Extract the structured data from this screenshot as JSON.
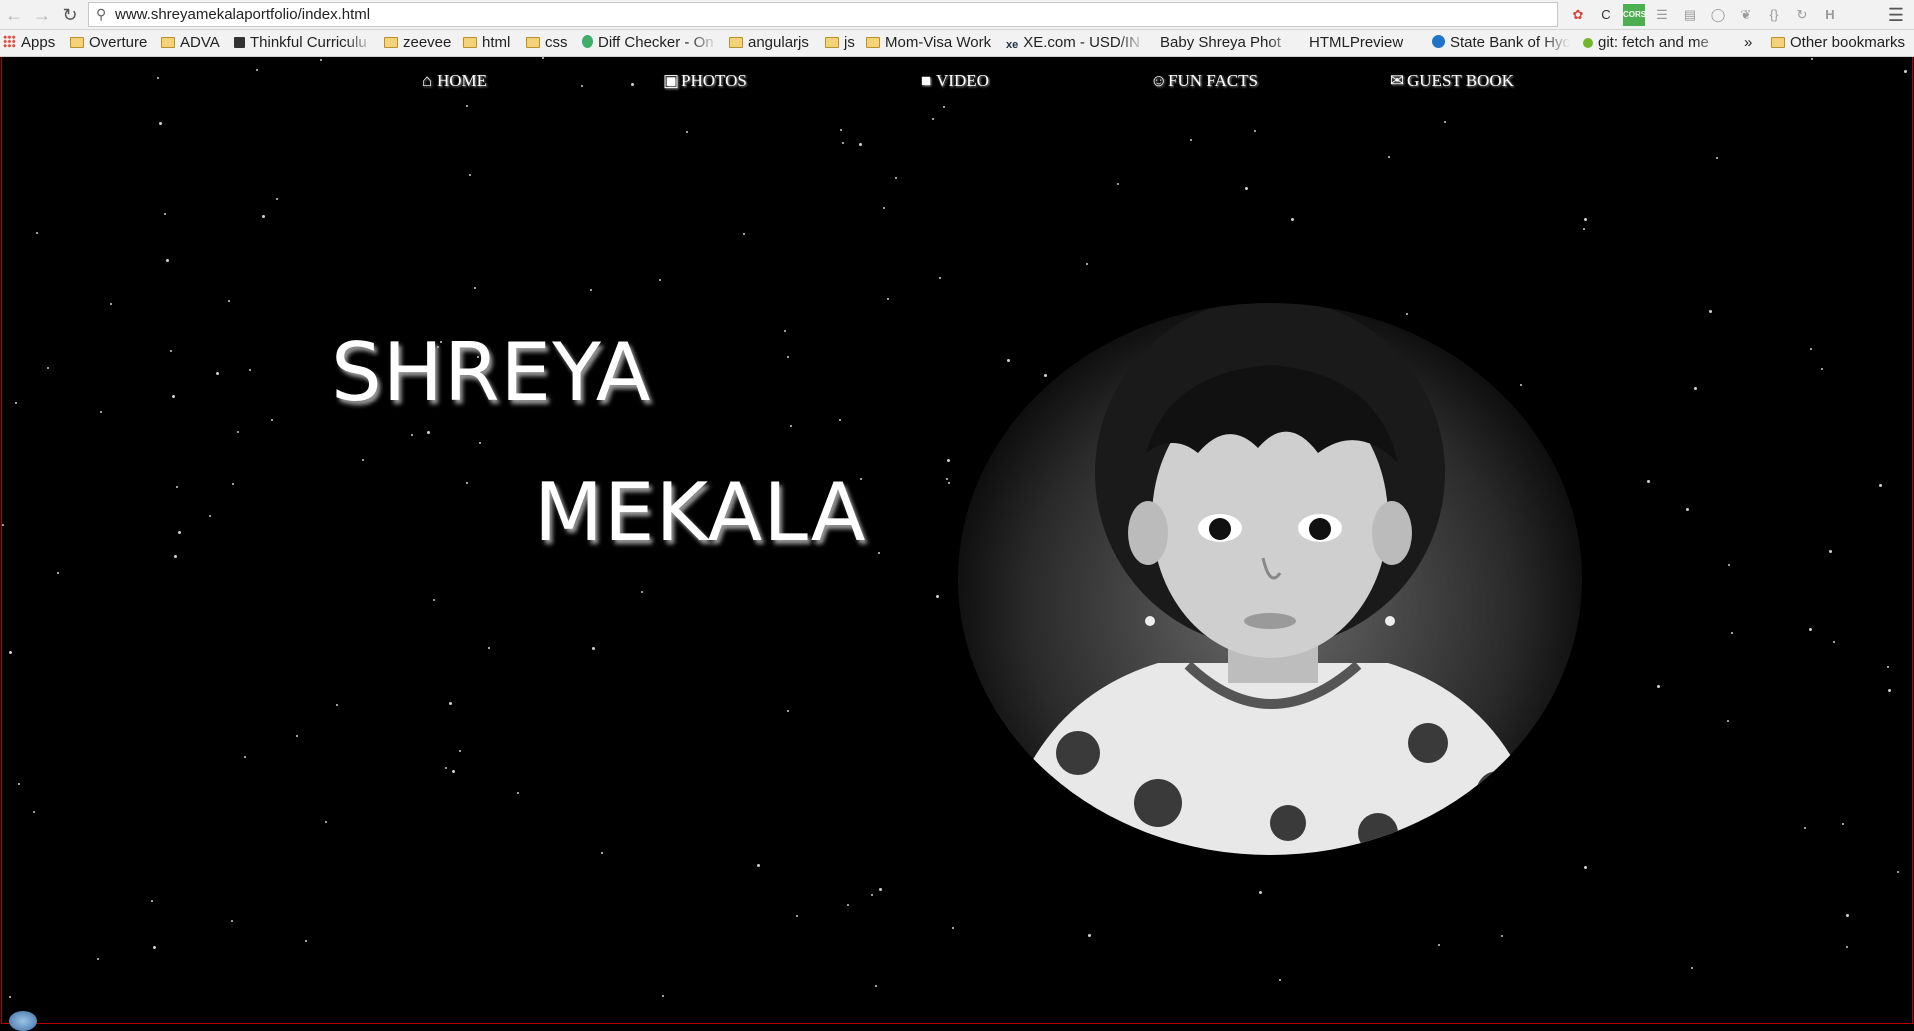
{
  "browser": {
    "url": "www.shreyamekalaportfolio/index.html",
    "bookmarks": [
      {
        "label": "Apps",
        "icon": "apps-grid-icon"
      },
      {
        "label": "Overture",
        "icon": "folder-icon"
      },
      {
        "label": "ADVA",
        "icon": "folder-icon"
      },
      {
        "label": "Thinkful Curriculu",
        "icon": "thinkful-icon"
      },
      {
        "label": "zeevee",
        "icon": "folder-icon"
      },
      {
        "label": "html",
        "icon": "folder-icon"
      },
      {
        "label": "css",
        "icon": "folder-icon"
      },
      {
        "label": "Diff Checker - On",
        "icon": "diffchecker-icon"
      },
      {
        "label": "angularjs",
        "icon": "folder-icon"
      },
      {
        "label": "js",
        "icon": "folder-icon"
      },
      {
        "label": "Mom-Visa Work",
        "icon": "folder-icon"
      },
      {
        "label": "XE.com - USD/IN",
        "icon": "xe-icon"
      },
      {
        "label": "Baby Shreya Phot",
        "icon": "page-icon"
      },
      {
        "label": "HTMLPreview",
        "icon": "page-icon"
      },
      {
        "label": "State Bank of Hyc",
        "icon": "sbh-icon"
      },
      {
        "label": "git: fetch and me",
        "icon": "git-icon"
      }
    ],
    "overflow": "»",
    "other_bookmarks": "Other bookmarks"
  },
  "nav": {
    "home": "HOME",
    "photos": "PHOTOS",
    "video": "VIDEO",
    "fun_facts": "FUN FACTS",
    "guest_book": "GUEST BOOK"
  },
  "hero": {
    "first_name": "SHREYA",
    "last_name": "MEKALA"
  },
  "colors": {
    "background": "#000000",
    "text": "#ffffff",
    "text_shadow": "#9a9a9a"
  }
}
